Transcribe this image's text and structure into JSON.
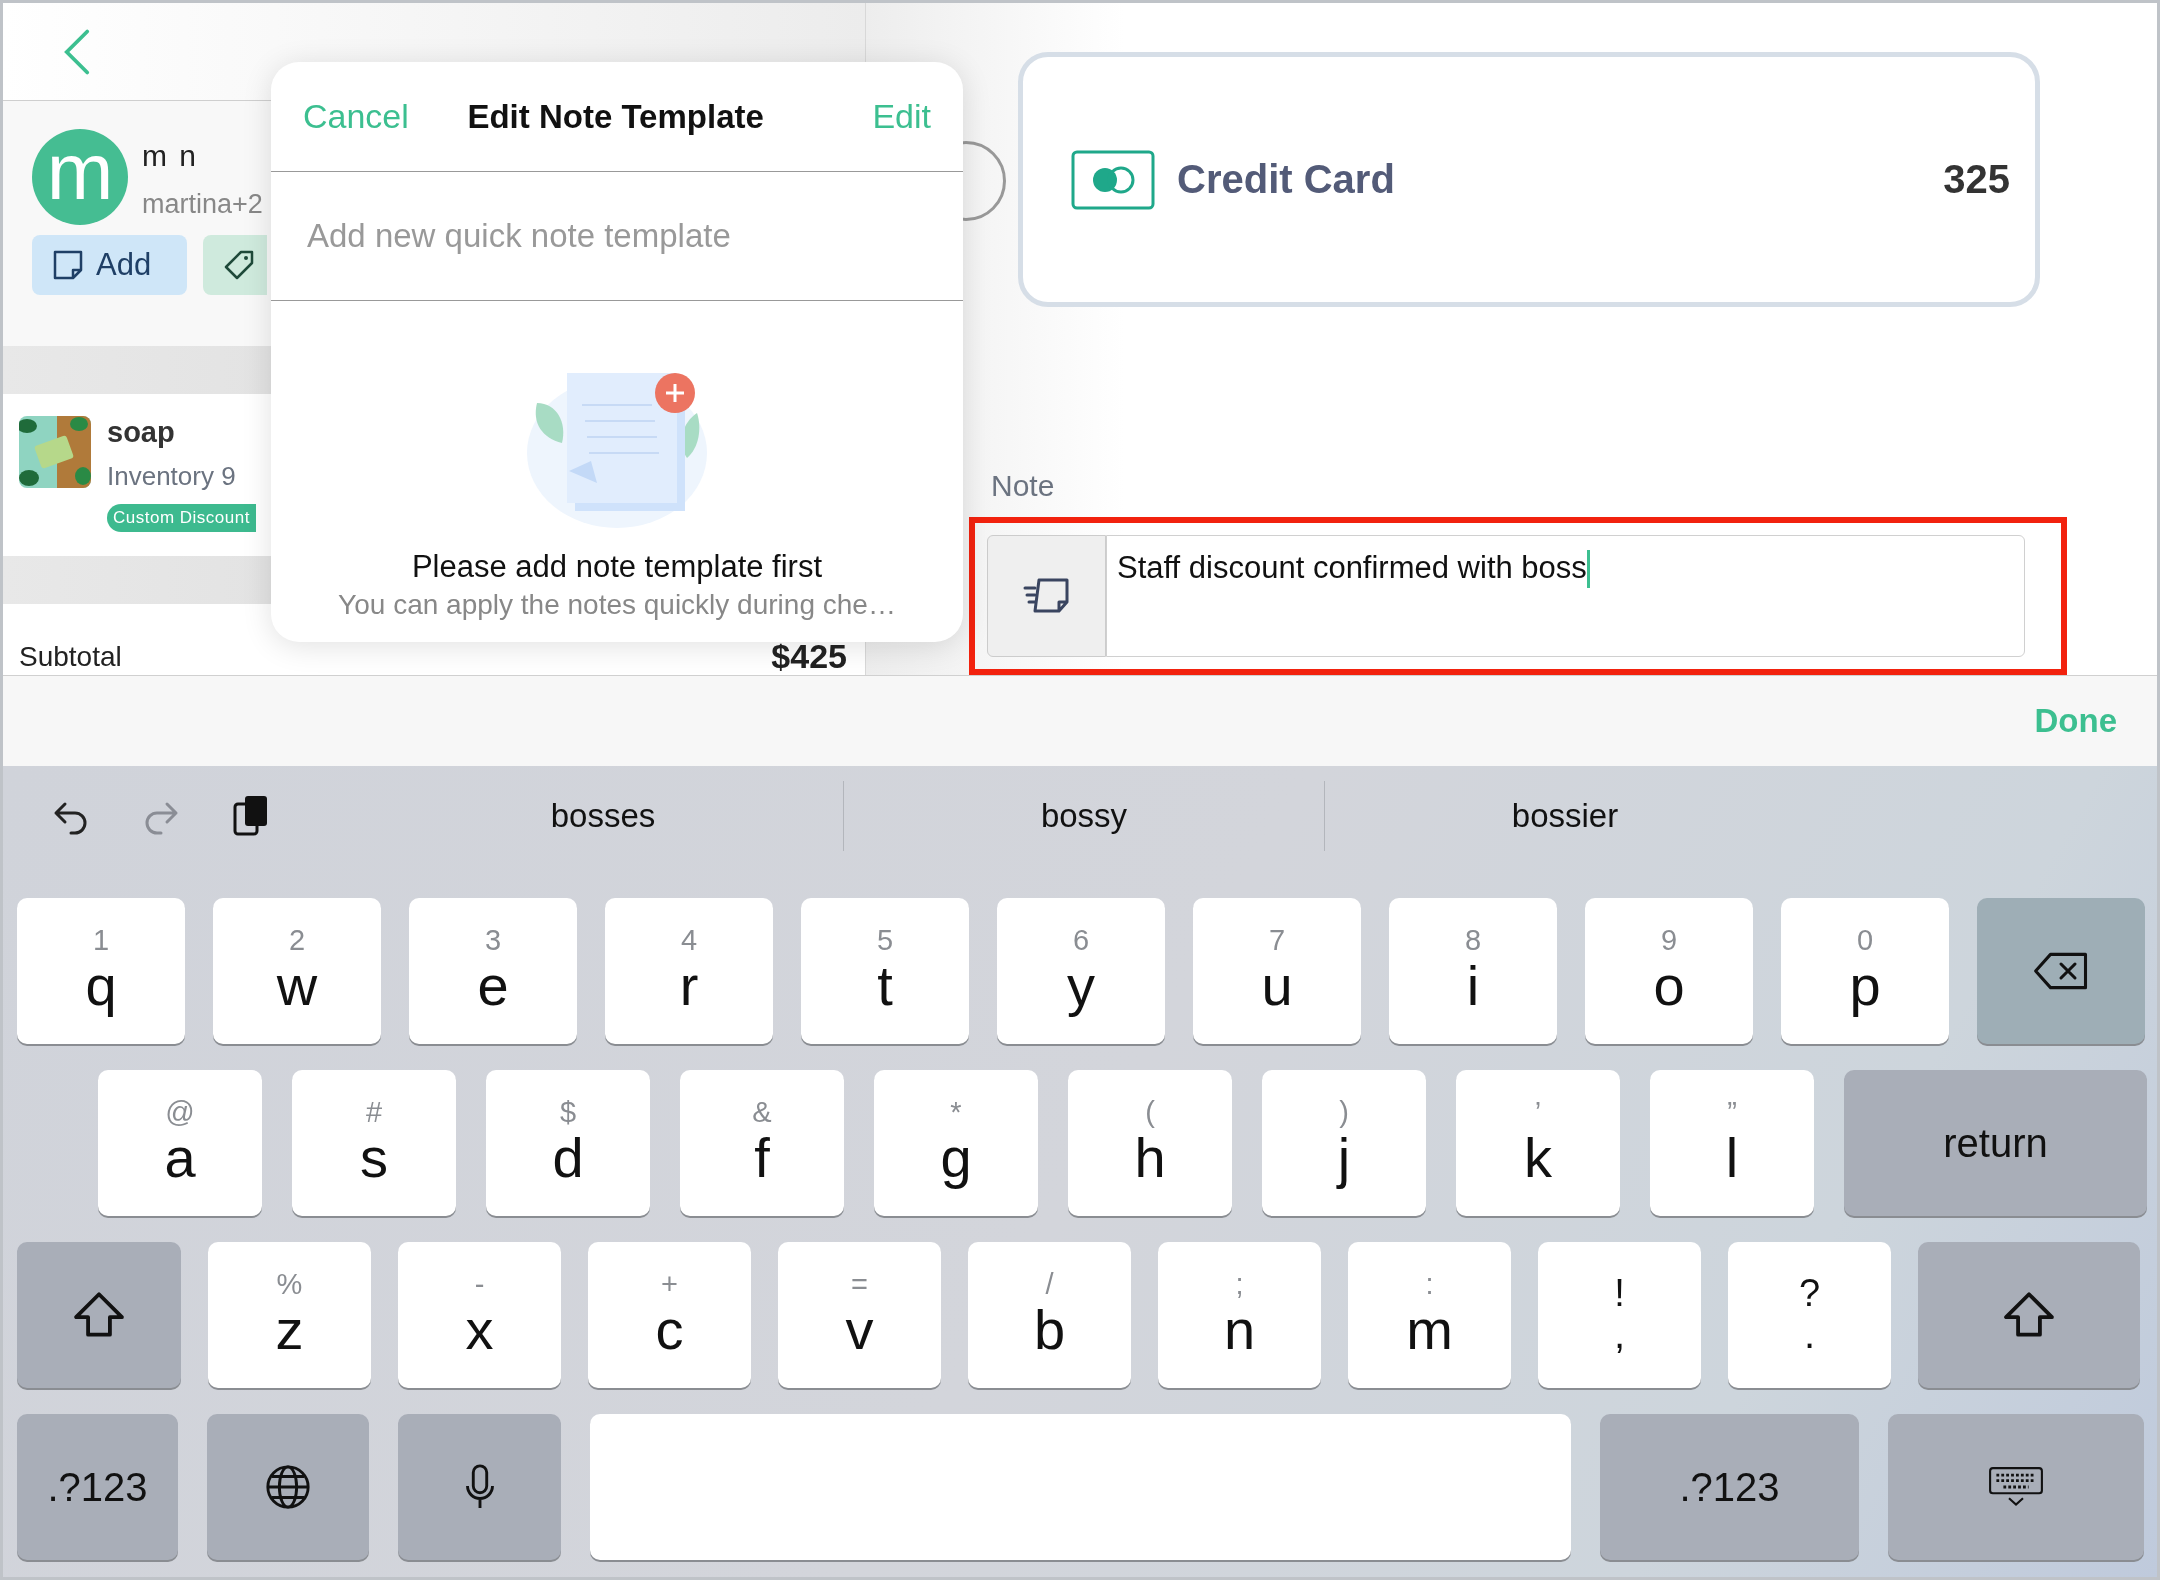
{
  "left_panel": {
    "customer": {
      "avatar_letter": "m",
      "name": "m n",
      "email": "martina+2"
    },
    "add_button": {
      "label": "Add"
    },
    "item": {
      "name": "soap",
      "inventory": "Inventory 9",
      "badge": "Custom Discount"
    },
    "subtotal": {
      "label": "Subtotal",
      "value": "$425"
    }
  },
  "popover": {
    "cancel": "Cancel",
    "title": "Edit Note Template",
    "edit": "Edit",
    "input": {
      "placeholder": "Add new quick note template"
    },
    "empty_title": "Please add note template first",
    "empty_text": "You can apply the notes quickly during che…"
  },
  "payment": {
    "method": "Credit Card",
    "amount": "325"
  },
  "note": {
    "label": "Note",
    "value": "Staff discount confirmed with boss"
  },
  "accessory": {
    "done": "Done"
  },
  "keyboard": {
    "suggestions": [
      "bosses",
      "bossy",
      "bossier"
    ],
    "rows": [
      [
        {
          "kind": "letter",
          "hint": "1",
          "label": "q"
        },
        {
          "kind": "letter",
          "hint": "2",
          "label": "w"
        },
        {
          "kind": "letter",
          "hint": "3",
          "label": "e"
        },
        {
          "kind": "letter",
          "hint": "4",
          "label": "r"
        },
        {
          "kind": "letter",
          "hint": "5",
          "label": "t"
        },
        {
          "kind": "letter",
          "hint": "6",
          "label": "y"
        },
        {
          "kind": "letter",
          "hint": "7",
          "label": "u"
        },
        {
          "kind": "letter",
          "hint": "8",
          "label": "i"
        },
        {
          "kind": "letter",
          "hint": "9",
          "label": "o"
        },
        {
          "kind": "letter",
          "hint": "0",
          "label": "p"
        },
        {
          "kind": "delete"
        }
      ],
      [
        {
          "kind": "letter",
          "hint": "@",
          "label": "a"
        },
        {
          "kind": "letter",
          "hint": "#",
          "label": "s"
        },
        {
          "kind": "letter",
          "hint": "$",
          "label": "d"
        },
        {
          "kind": "letter",
          "hint": "&",
          "label": "f"
        },
        {
          "kind": "letter",
          "hint": "*",
          "label": "g"
        },
        {
          "kind": "letter",
          "hint": "(",
          "label": "h"
        },
        {
          "kind": "letter",
          "hint": ")",
          "label": "j"
        },
        {
          "kind": "letter",
          "hint": "’",
          "label": "k"
        },
        {
          "kind": "letter",
          "hint": "”",
          "label": "l"
        },
        {
          "kind": "return",
          "label": "return"
        }
      ],
      [
        {
          "kind": "shift"
        },
        {
          "kind": "letter",
          "hint": "%",
          "label": "z"
        },
        {
          "kind": "letter",
          "hint": "-",
          "label": "x"
        },
        {
          "kind": "letter",
          "hint": "+",
          "label": "c"
        },
        {
          "kind": "letter",
          "hint": "=",
          "label": "v"
        },
        {
          "kind": "letter",
          "hint": "/",
          "label": "b"
        },
        {
          "kind": "letter",
          "hint": ";",
          "label": "n"
        },
        {
          "kind": "letter",
          "hint": ":",
          "label": "m"
        },
        {
          "kind": "dual",
          "hint": "!",
          "label": ","
        },
        {
          "kind": "dual",
          "hint": "?",
          "label": "."
        },
        {
          "kind": "shift"
        }
      ],
      [
        {
          "kind": "numbers",
          "label": ".?123"
        },
        {
          "kind": "globe"
        },
        {
          "kind": "mic"
        },
        {
          "kind": "space"
        },
        {
          "kind": "numbers",
          "label": ".?123"
        },
        {
          "kind": "dismiss"
        }
      ]
    ]
  }
}
